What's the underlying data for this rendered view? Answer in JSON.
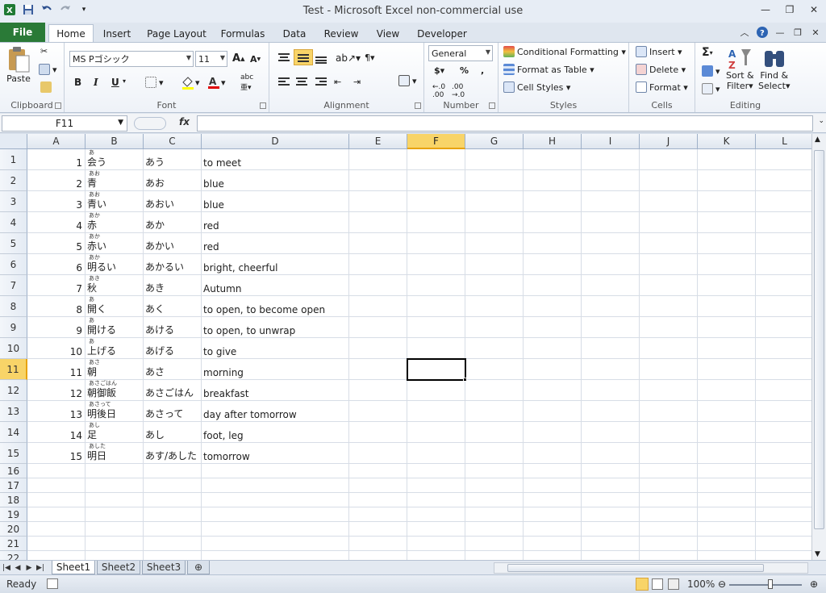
{
  "window": {
    "title": "Test  -  Microsoft Excel non-commercial use"
  },
  "ribbon_tabs": [
    "File",
    "Home",
    "Insert",
    "Page Layout",
    "Formulas",
    "Data",
    "Review",
    "View",
    "Developer"
  ],
  "clipboard": {
    "paste": "Paste",
    "label": "Clipboard"
  },
  "font": {
    "name": "MS Pゴシック",
    "size": "11",
    "bold": "B",
    "italic": "I",
    "underline": "U",
    "label": "Font"
  },
  "alignment": {
    "label": "Alignment"
  },
  "number": {
    "format": "General",
    "currency": "$",
    "percent": "%",
    "comma": ",",
    "label": "Number"
  },
  "styles": {
    "conditional": "Conditional Formatting",
    "table": "Format as Table",
    "cell_styles": "Cell Styles",
    "label": "Styles"
  },
  "cells": {
    "insert": "Insert",
    "delete": "Delete",
    "format": "Format",
    "label": "Cells"
  },
  "editing": {
    "sigma": "Σ",
    "sort": "Sort &",
    "filter": "Filter",
    "find": "Find &",
    "select": "Select",
    "label": "Editing"
  },
  "formula_bar": {
    "name_box": "F11",
    "fx": "fx",
    "value": ""
  },
  "columns": [
    "A",
    "B",
    "C",
    "D",
    "E",
    "F",
    "G",
    "H",
    "I",
    "J",
    "K",
    "L"
  ],
  "selected_column": "F",
  "rows": [
    "1",
    "2",
    "3",
    "4",
    "5",
    "6",
    "7",
    "8",
    "9",
    "10",
    "11",
    "12",
    "13",
    "14",
    "15",
    "16",
    "17",
    "18",
    "19",
    "20",
    "21",
    "22"
  ],
  "selected_row": "11",
  "data_rows": [
    {
      "a": "1",
      "furi": "あ",
      "b": "会う",
      "c": "あう",
      "d": "to meet"
    },
    {
      "a": "2",
      "furi": "あお",
      "b": "青",
      "c": "あお",
      "d": "blue"
    },
    {
      "a": "3",
      "furi": "あお",
      "b": "青い",
      "c": "あおい",
      "d": "blue"
    },
    {
      "a": "4",
      "furi": "あか",
      "b": "赤",
      "c": "あか",
      "d": "red"
    },
    {
      "a": "5",
      "furi": "あか",
      "b": "赤い",
      "c": "あかい",
      "d": "red"
    },
    {
      "a": "6",
      "furi": "あか",
      "b": "明るい",
      "c": "あかるい",
      "d": "bright, cheerful"
    },
    {
      "a": "7",
      "furi": "あき",
      "b": "秋",
      "c": "あき",
      "d": "Autumn"
    },
    {
      "a": "8",
      "furi": "あ",
      "b": "開く",
      "c": "あく",
      "d": "to open, to become open"
    },
    {
      "a": "9",
      "furi": "あ",
      "b": "開ける",
      "c": "あける",
      "d": "to open, to unwrap"
    },
    {
      "a": "10",
      "furi": "あ",
      "b": "上げる",
      "c": "あげる",
      "d": "to give"
    },
    {
      "a": "11",
      "furi": "あさ",
      "b": "朝",
      "c": "あさ",
      "d": "morning"
    },
    {
      "a": "12",
      "furi": "あさごはん",
      "b": "朝御飯",
      "c": "あさごはん",
      "d": "breakfast"
    },
    {
      "a": "13",
      "furi": "あさって",
      "b": "明後日",
      "c": "あさって",
      "d": "day after tomorrow"
    },
    {
      "a": "14",
      "furi": "あし",
      "b": "足",
      "c": "あし",
      "d": "foot, leg"
    },
    {
      "a": "15",
      "furi": "あした",
      "b": "明日",
      "c": "あす/あした",
      "d": "tomorrow"
    }
  ],
  "sheets": [
    "Sheet1",
    "Sheet2",
    "Sheet3"
  ],
  "active_sheet": "Sheet1",
  "status": {
    "ready": "Ready",
    "zoom": "100%"
  },
  "colors": {
    "file_tab": "#2a7a37",
    "selection_header": "#f8d468"
  }
}
